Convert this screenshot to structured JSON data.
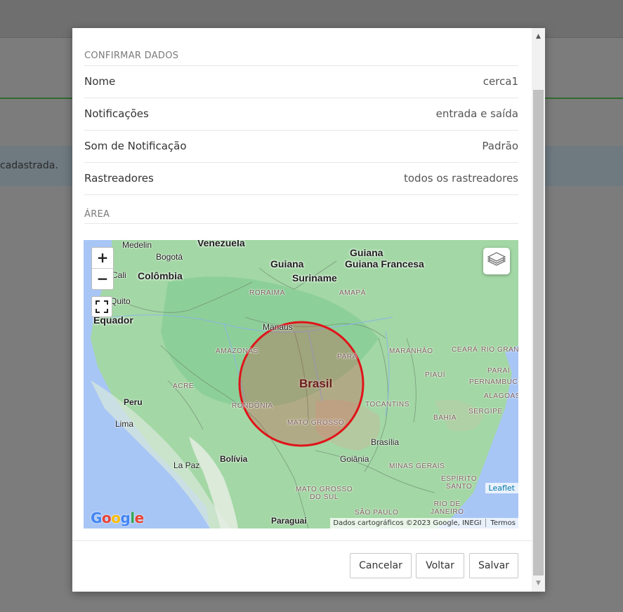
{
  "background": {
    "info_text": "cadastrada."
  },
  "modal": {
    "section_confirm_title": "CONFIRMAR DADOS",
    "rows": [
      {
        "label": "Nome",
        "value": "cerca1"
      },
      {
        "label": "Notificações",
        "value": "entrada e saída"
      },
      {
        "label": "Som de Notificação",
        "value": "Padrão"
      },
      {
        "label": "Rastreadores",
        "value": "todos os rastreadores"
      }
    ],
    "section_area_title": "ÁREA"
  },
  "map": {
    "zoom_in": "+",
    "zoom_out": "−",
    "leaflet_attr": "Leaflet",
    "attribution": "Dados cartográficos ©2023 Google, INEGI",
    "terms": "Termos",
    "google_logo": "Google",
    "fence_color": "#e0141a",
    "labels": {
      "medelin": "Medelin",
      "venezuela": "Venezuela",
      "bogota": "Bogotá",
      "colombia": "Colômbia",
      "cali": "Cali",
      "quito": "Quito",
      "equador": "Equador",
      "guiana": "Guiana",
      "guiana_francesa": "Guiana Francesa",
      "suriname": "Suriname",
      "roraima": "RORAIMA",
      "amapa": "AMAPÁ",
      "manaus": "Manaus",
      "amazonas": "AMAZONAS",
      "para": "PARÁ",
      "maranhao": "MARANHÃO",
      "ceara": "CEARÁ",
      "rio_grande": "RIO GRAN",
      "paraiba": "PARAÍ",
      "piaui": "PIAUÍ",
      "pernambuco": "PERNAMBUCO",
      "alagoas": "ALAGOAS",
      "sergipe": "SERGIPE",
      "acre": "ACRE",
      "brasil": "Brasil",
      "rondonia": "RONDÔNIA",
      "tocantins": "TOCANTINS",
      "bahia": "BAHIA",
      "mato_grosso": "MATO GROSSO",
      "peru": "Peru",
      "lima": "Lima",
      "brasilia": "Brasília",
      "goiania": "Goiânia",
      "minas_gerais": "MINAS GERAIS",
      "la_paz": "La Paz",
      "bolivia": "Bolívia",
      "espirito_santo_1": "ESPÍRITO",
      "espirito_santo_2": "SANTO",
      "mato_grosso_sul_1": "MATO GROSSO",
      "mato_grosso_sul_2": "DO SUL",
      "rio_de_janeiro_1": "RIO DE",
      "rio_de_janeiro_2": "JANEIRO",
      "sao_paulo": "SÃO PAULO",
      "paraguai": "Paraguai"
    }
  },
  "footer": {
    "cancel": "Cancelar",
    "back": "Voltar",
    "save": "Salvar"
  }
}
